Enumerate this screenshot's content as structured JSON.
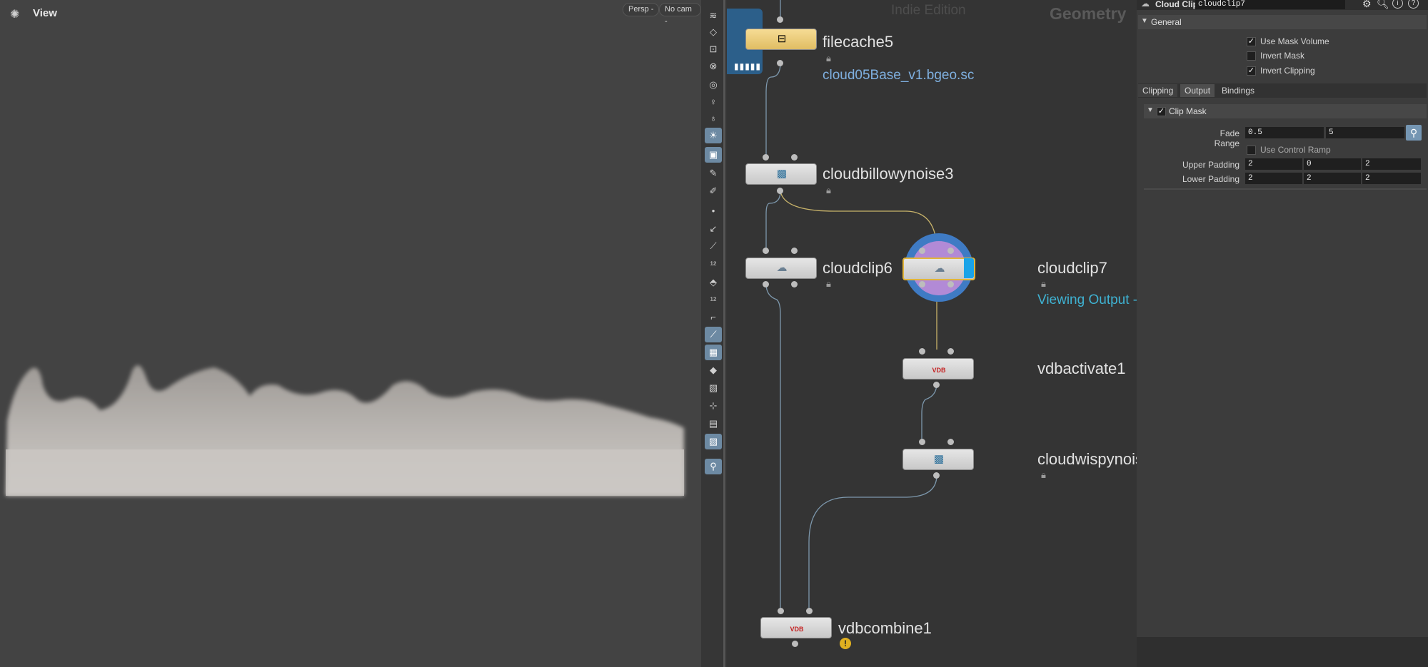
{
  "viewport": {
    "title": "View",
    "persp_label": "Persp -",
    "cam_label": "No cam -"
  },
  "network": {
    "edition": "Indie Edition",
    "context": "Geometry",
    "nodes": {
      "filecache": {
        "name": "filecache5",
        "subtitle": "cloud05Base_v1.bgeo.sc"
      },
      "billowy": {
        "name": "cloudbillowynoise3"
      },
      "clip6": {
        "name": "cloudclip6"
      },
      "clip7": {
        "name": "cloudclip7",
        "subtitle": "Viewing Output -"
      },
      "vdbactivate": {
        "name": "vdbactivate1",
        "icon_text": "VDB"
      },
      "wispy": {
        "name": "cloudwispynois"
      },
      "combine": {
        "name": "vdbcombine1",
        "icon_text": "VDB"
      }
    }
  },
  "params": {
    "node_type": "Cloud Clip",
    "node_name": "cloudclip7",
    "general_header": "General",
    "use_mask_volume": {
      "label": "Use Mask Volume",
      "checked": true
    },
    "invert_mask": {
      "label": "Invert Mask",
      "checked": false
    },
    "invert_clipping": {
      "label": "Invert Clipping",
      "checked": true
    },
    "tabs": [
      "Clipping",
      "Output",
      "Bindings"
    ],
    "clip_mask_header": "Clip Mask",
    "fade_range": {
      "label": "Fade Range",
      "v1": "0.5",
      "v2": "5"
    },
    "use_control_ramp": {
      "label": "Use Control Ramp"
    },
    "upper_padding": {
      "label": "Upper Padding",
      "x": "2",
      "y": "0",
      "z": "2"
    },
    "lower_padding": {
      "label": "Lower Padding",
      "x": "2",
      "y": "2",
      "z": "2"
    }
  }
}
